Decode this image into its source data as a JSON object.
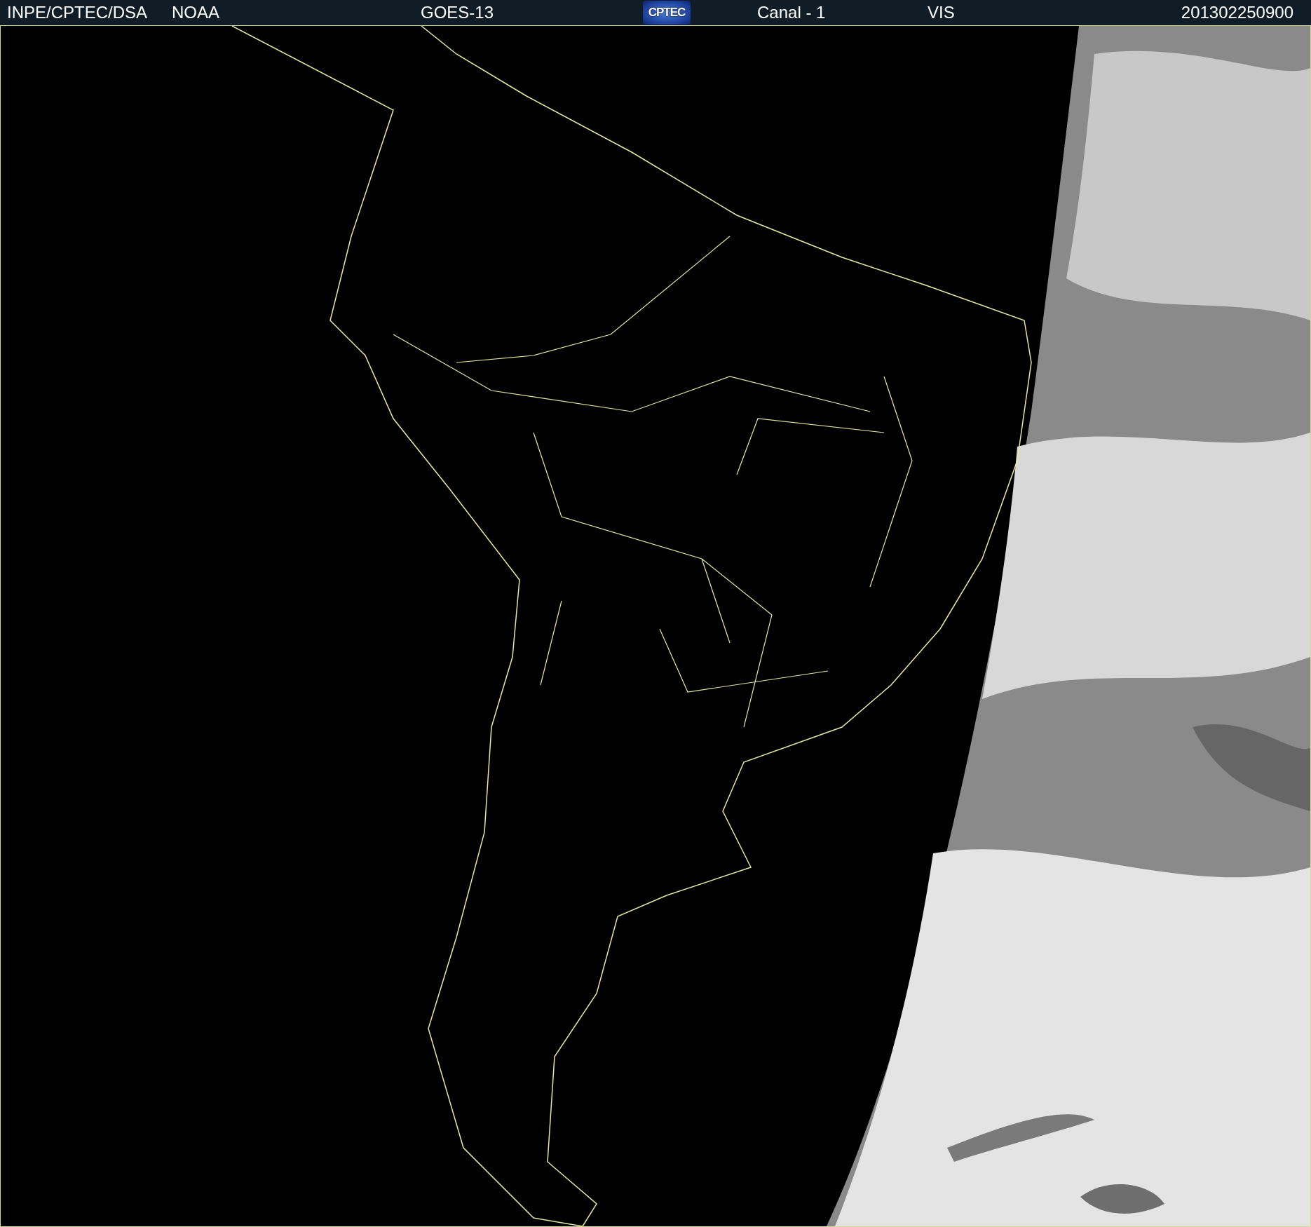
{
  "header": {
    "items": [
      {
        "kind": "text",
        "text": "INPE/CPTEC/DSA"
      },
      {
        "kind": "text",
        "text": "NOAA"
      },
      {
        "kind": "text",
        "text": "GOES-13"
      },
      {
        "kind": "logo",
        "text": "CPTEC"
      },
      {
        "kind": "text",
        "text": "Canal - 1"
      },
      {
        "kind": "text",
        "text": "VIS"
      },
      {
        "kind": "text",
        "text": "201302250900"
      }
    ]
  }
}
